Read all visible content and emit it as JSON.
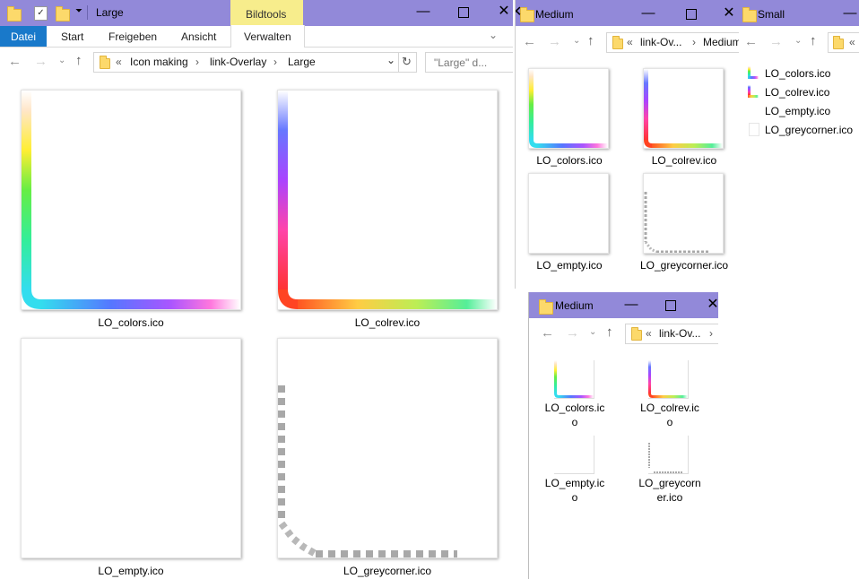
{
  "large": {
    "title": "Large",
    "context_tab": "Bildtools",
    "ribbon": [
      "Datei",
      "Start",
      "Freigeben",
      "Ansicht",
      "Verwalten"
    ],
    "path_prefix": "«",
    "path": [
      "Icon making",
      "link-Overlay",
      "Large"
    ],
    "search_placeholder": "\"Large\" d...",
    "files": [
      "LO_colors.ico",
      "LO_colrev.ico",
      "LO_empty.ico",
      "LO_greycorner.ico"
    ]
  },
  "medium_top": {
    "title": "Medium",
    "path_prefix": "«",
    "path": [
      "link-Ov...",
      "Medium"
    ],
    "files": [
      "LO_colors.ico",
      "LO_colrev.ico",
      "LO_empty.ico",
      "LO_greycorner.ico"
    ]
  },
  "small": {
    "title": "Small",
    "path_prefix": "«",
    "files": [
      "LO_colors.ico",
      "LO_colrev.ico",
      "LO_empty.ico",
      "LO_greycorner.ico"
    ]
  },
  "medium_bottom": {
    "title": "Medium",
    "path_prefix": "«",
    "path": [
      "link-Ov..."
    ],
    "files": [
      "LO_colors.ico",
      "LO_colrev.ico",
      "LO_empty.ico",
      "LO_greycorner.ico"
    ]
  },
  "icons": {
    "minimize": "minimize-icon",
    "maximize": "maximize-icon",
    "close": "close-icon",
    "back": "back-arrow-icon",
    "forward": "forward-arrow-icon",
    "up": "up-arrow-icon",
    "refresh": "refresh-icon",
    "folder": "folder-icon"
  },
  "colors": {
    "titlebar": "#9289d9",
    "ribbon_file_tab": "#1979ca",
    "context_tab": "#f7ed8c"
  }
}
